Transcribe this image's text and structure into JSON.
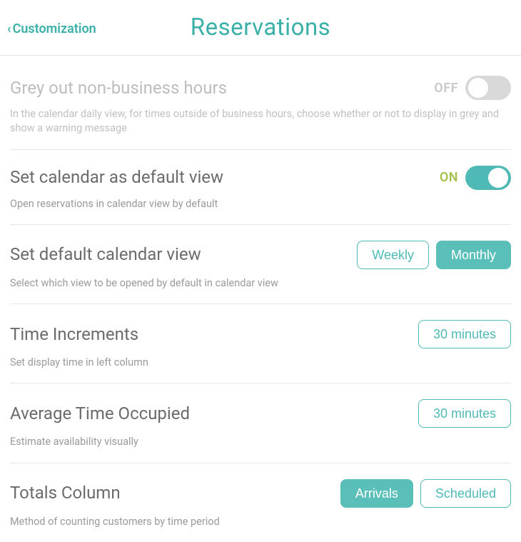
{
  "header": {
    "back_label": "Customization",
    "title": "Reservations"
  },
  "rows": {
    "grey": {
      "title": "Grey out non-business hours",
      "desc": "In the calendar daily view, for times outside of business hours, choose whether or not to display in grey and show a warning message",
      "state_label": "OFF"
    },
    "default_view": {
      "title": "Set calendar as default view",
      "desc": "Open reservations in calendar view by default",
      "state_label": "ON"
    },
    "calendar_view": {
      "title": "Set default calendar view",
      "desc": "Select which view to be opened by default in calendar view",
      "opt_weekly": "Weekly",
      "opt_monthly": "Monthly"
    },
    "time_inc": {
      "title": "Time Increments",
      "desc": "Set display time in left column",
      "value": "30 minutes"
    },
    "avg_time": {
      "title": "Average Time Occupied",
      "desc": "Estimate availability visually",
      "value": "30 minutes"
    },
    "totals": {
      "title": "Totals Column",
      "desc": "Method of counting customers by time period",
      "opt_arrivals": "Arrivals",
      "opt_scheduled": "Scheduled"
    }
  }
}
